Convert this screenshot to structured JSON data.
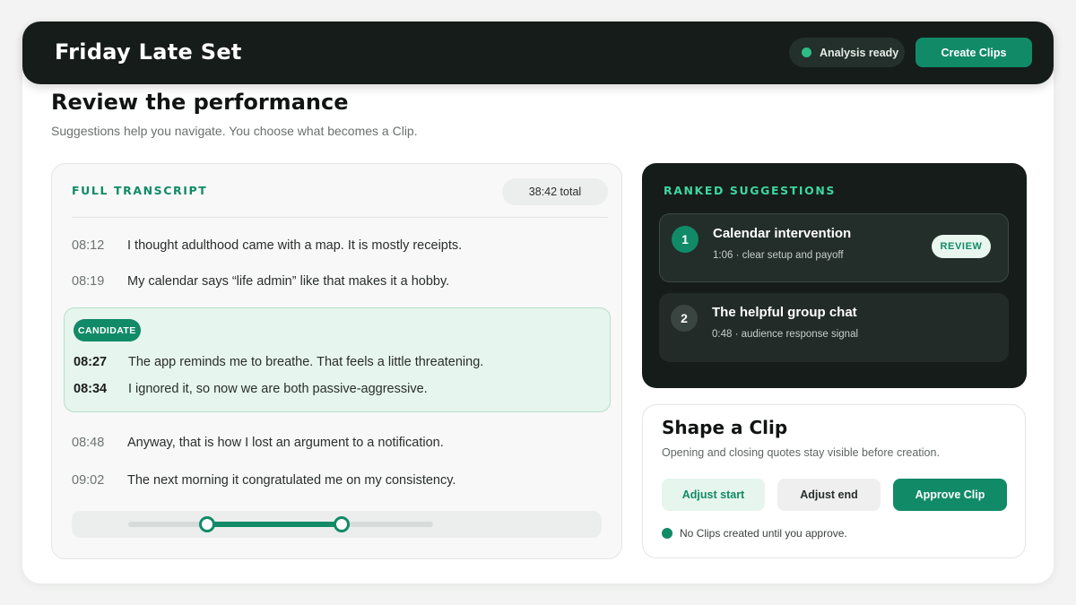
{
  "header": {
    "title": "Friday Late Set",
    "status_text": "Analysis ready",
    "create_button": "Create Clips"
  },
  "page": {
    "title": "Review the performance",
    "subtitle": "Suggestions help you navigate. You choose what becomes a Clip."
  },
  "transcript": {
    "heading": "FULL TRANSCRIPT",
    "total": "38:42 total",
    "lines_before": [
      {
        "time": "08:12",
        "text": "I thought adulthood came with a map. It is mostly receipts."
      },
      {
        "time": "08:19",
        "text": "My calendar says “life admin” like that makes it a hobby."
      }
    ],
    "candidate": {
      "badge": "CANDIDATE",
      "lines": [
        {
          "time": "08:27",
          "text": "The app reminds me to breathe. That feels a little threatening."
        },
        {
          "time": "08:34",
          "text": "I ignored it, so now we are both passive-aggressive."
        }
      ]
    },
    "lines_after": [
      {
        "time": "08:48",
        "text": "Anyway, that is how I lost an argument to a notification."
      },
      {
        "time": "09:02",
        "text": "The next morning it congratulated me on my consistency."
      }
    ],
    "selection": {
      "start_fraction": 0.26,
      "end_fraction": 0.7
    }
  },
  "suggestions": {
    "heading": "RANKED SUGGESTIONS",
    "items": [
      {
        "rank": "1",
        "title": "Calendar intervention",
        "meta": "1:06 · clear setup and payoff",
        "action": "REVIEW"
      },
      {
        "rank": "2",
        "title": "The helpful group chat",
        "meta": "0:48 · audience response signal"
      }
    ]
  },
  "shape": {
    "title": "Shape a Clip",
    "subtitle": "Opening and closing quotes stay visible before creation.",
    "adjust_start": "Adjust start",
    "adjust_end": "Adjust end",
    "approve": "Approve Clip",
    "note": "No Clips created until you approve."
  },
  "colors": {
    "accent": "#118a67",
    "dark": "#161c1a",
    "candidate_bg": "#e6f5ed",
    "status_dot": "#2ebd85"
  }
}
